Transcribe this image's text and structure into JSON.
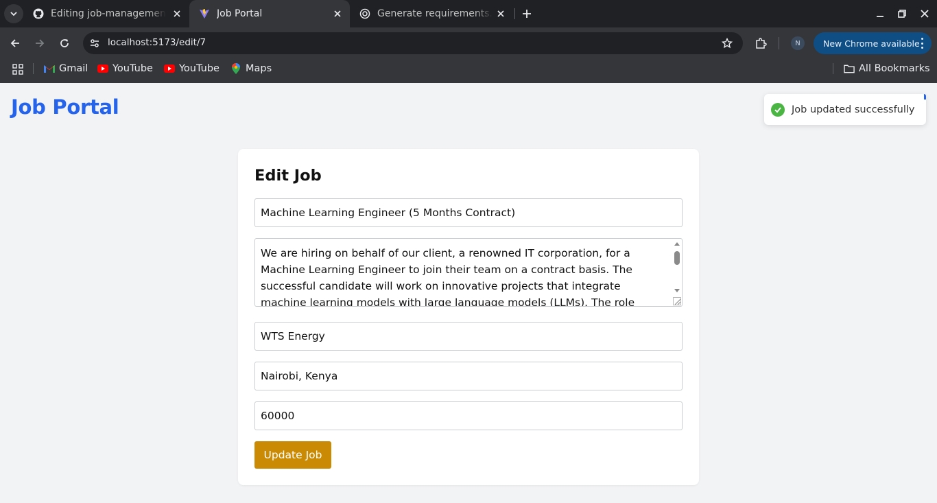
{
  "browser": {
    "tabs": [
      {
        "title": "Editing job-management",
        "active": false
      },
      {
        "title": "Job Portal",
        "active": true
      },
      {
        "title": "Generate requirements.tx",
        "active": false
      }
    ],
    "url": "localhost:5173/edit/7",
    "profile_initial": "N",
    "update_label": "New Chrome available",
    "bookmarks": [
      "Gmail",
      "YouTube",
      "YouTube",
      "Maps"
    ],
    "all_bookmarks_label": "All Bookmarks"
  },
  "app": {
    "brand": "Job Portal",
    "toast": "Job updated successfully"
  },
  "form": {
    "heading": "Edit Job",
    "title_value": "Machine Learning Engineer (5 Months Contract)",
    "description_value": "We are hiring on behalf of our client, a renowned IT corporation, for a Machine Learning Engineer to join their team on a contract basis. The successful candidate will work on innovative projects that integrate machine learning models with large language models (LLMs). The role focuses on enhancing natural language",
    "company_value": "WTS Energy",
    "location_value": "Nairobi, Kenya",
    "salary_value": "60000",
    "submit_label": "Update Job"
  },
  "colors": {
    "brand": "#2563eb",
    "button": "#ca8a04",
    "success": "#4bb543"
  }
}
